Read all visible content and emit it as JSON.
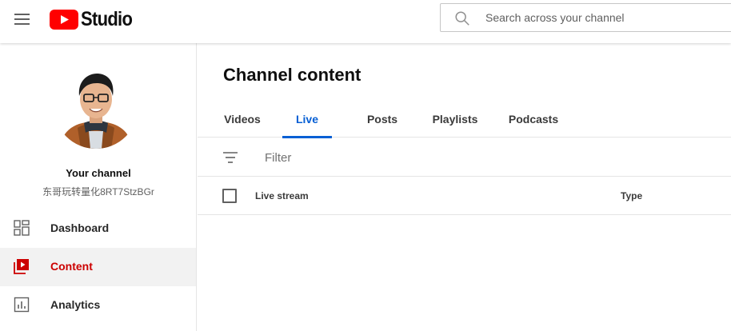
{
  "app": {
    "logo_text": "Studio",
    "brand_color": "#FF0000"
  },
  "header": {
    "menu_icon": "hamburger-menu-icon",
    "search_placeholder": "Search across your channel",
    "search_value": ""
  },
  "sidebar": {
    "channel_title": "Your channel",
    "channel_handle": "东哥玩转量化8RT7StzBGr",
    "items": [
      {
        "label": "Dashboard",
        "icon": "dashboard-icon",
        "active": false
      },
      {
        "label": "Content",
        "icon": "content-icon",
        "active": true
      },
      {
        "label": "Analytics",
        "icon": "analytics-icon",
        "active": false
      }
    ]
  },
  "main": {
    "title": "Channel content",
    "tabs": [
      {
        "label": "Videos",
        "active": false
      },
      {
        "label": "Live",
        "active": true
      },
      {
        "label": "Posts",
        "active": false
      },
      {
        "label": "Playlists",
        "active": false
      },
      {
        "label": "Podcasts",
        "active": false
      }
    ],
    "filter": {
      "placeholder": "Filter",
      "value": ""
    },
    "table": {
      "columns": [
        "Live stream",
        "Type"
      ]
    }
  },
  "colors": {
    "accent": "#065fd4",
    "active_nav": "#cc0000"
  }
}
